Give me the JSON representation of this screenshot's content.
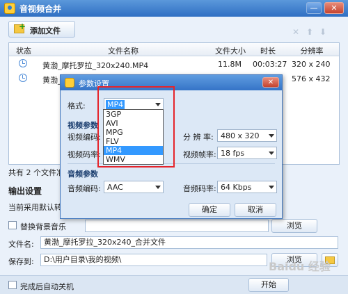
{
  "window": {
    "title": "音视频合并",
    "min_glyph": "—",
    "close_glyph": "✕"
  },
  "toolbar": {
    "add_file_label": "添加文件",
    "icons": [
      "delete-icon",
      "arrow-up-icon",
      "arrow-down-icon"
    ],
    "delete_glyph": "✕",
    "up_glyph": "⬆",
    "down_glyph": "⬇"
  },
  "table": {
    "columns": [
      "状态",
      "文件名称",
      "文件大小",
      "时长",
      "分辨率"
    ],
    "rows": [
      {
        "name": "黄渤_摩托罗拉_320x240.MP4",
        "size": "11.8M",
        "duration": "00:03:27",
        "resolution": "320 x 240"
      },
      {
        "name": "黄渤_摩托罗",
        "size": "",
        "duration": "",
        "resolution": "576 x 432"
      }
    ]
  },
  "status_text": "共有 2 个文件准",
  "output": {
    "title": "输出设置",
    "current_desc": "当前采用默认转码",
    "replace_bg_music_label": "替换背景音乐",
    "browse_label": "浏览",
    "filename_label": "文件名:",
    "filename_value": "黄渤_摩托罗拉_320x240_合并文件",
    "saveto_label": "保存到:",
    "saveto_value": "D:\\用户目录\\我的视频\\",
    "browse2_label": "浏览",
    "auto_shutdown_label": "完成后自动关机",
    "start_label": "开始"
  },
  "dialog": {
    "title": "参数设置",
    "close_glyph": "✕",
    "format_label": "格式:",
    "format_value": "MP4",
    "format_options": [
      "3GP",
      "AVI",
      "MPG",
      "FLV",
      "MP4",
      "WMV"
    ],
    "format_selected_index": 4,
    "video_section": "视频参数",
    "video_codec_label": "视频编码:",
    "resolution_label": "分 辨 率:",
    "resolution_value": "480 x 320",
    "video_bitrate_label": "视频码率:",
    "framerate_label": "视频帧率:",
    "framerate_value": "18 fps",
    "audio_section": "音频参数",
    "audio_codec_label": "音频编码:",
    "audio_codec_value": "AAC",
    "audio_bitrate_label": "音频码率:",
    "audio_bitrate_value": "64 Kbps",
    "ok_label": "确定",
    "cancel_label": "取消"
  },
  "annotation": {
    "highlight_color": "#e5242b"
  },
  "watermark": {
    "text": "Baidu 经验"
  }
}
